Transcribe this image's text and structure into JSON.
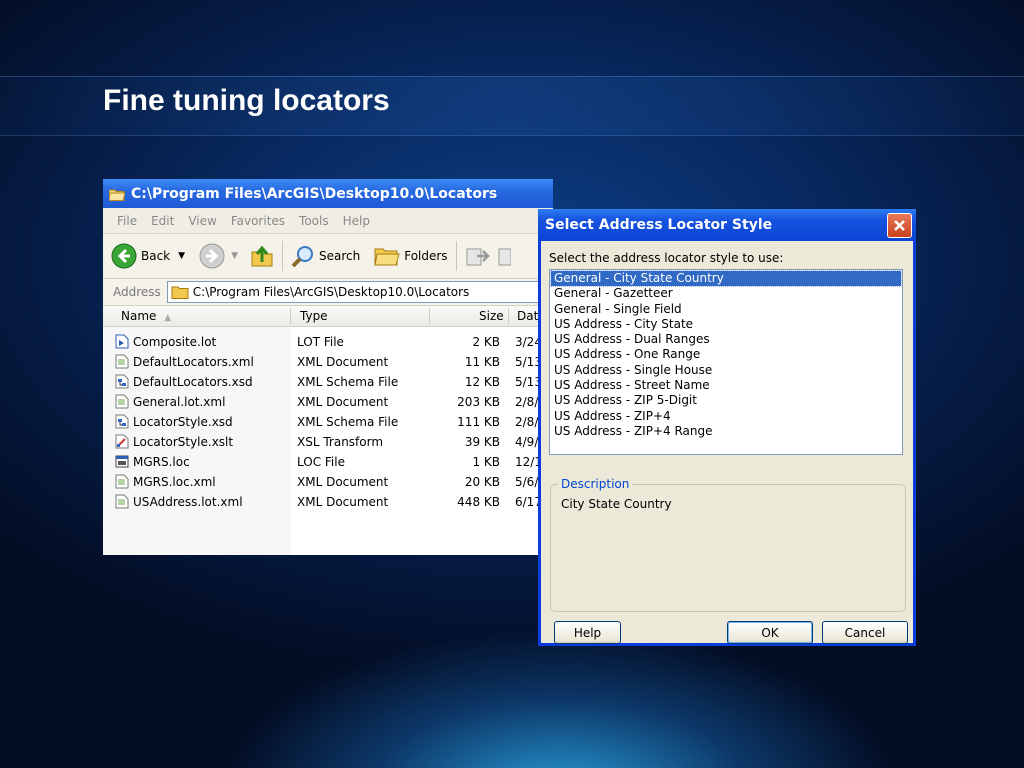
{
  "slide": {
    "title": "Fine tuning locators"
  },
  "explorer": {
    "title": "C:\\Program Files\\ArcGIS\\Desktop10.0\\Locators",
    "menu": [
      "File",
      "Edit",
      "View",
      "Favorites",
      "Tools",
      "Help"
    ],
    "toolbar": {
      "back": "Back",
      "search": "Search",
      "folders": "Folders"
    },
    "address_label": "Address",
    "address_value": "C:\\Program Files\\ArcGIS\\Desktop10.0\\Locators",
    "columns": {
      "name": "Name",
      "type": "Type",
      "size": "Size",
      "date": "Dat"
    },
    "files": [
      {
        "name": "Composite.lot",
        "type": "LOT File",
        "size": "2 KB",
        "date": "3/24",
        "icon": "lot-file-icon"
      },
      {
        "name": "DefaultLocators.xml",
        "type": "XML Document",
        "size": "11 KB",
        "date": "5/13",
        "icon": "xml-file-icon"
      },
      {
        "name": "DefaultLocators.xsd",
        "type": "XML Schema File",
        "size": "12 KB",
        "date": "5/13",
        "icon": "xsd-file-icon"
      },
      {
        "name": "General.lot.xml",
        "type": "XML Document",
        "size": "203 KB",
        "date": "2/8/",
        "icon": "xml-file-icon"
      },
      {
        "name": "LocatorStyle.xsd",
        "type": "XML Schema File",
        "size": "111 KB",
        "date": "2/8/",
        "icon": "xsd-file-icon"
      },
      {
        "name": "LocatorStyle.xslt",
        "type": "XSL Transform",
        "size": "39 KB",
        "date": "4/9/",
        "icon": "xslt-file-icon"
      },
      {
        "name": "MGRS.loc",
        "type": "LOC File",
        "size": "1 KB",
        "date": "12/1",
        "icon": "loc-file-icon"
      },
      {
        "name": "MGRS.loc.xml",
        "type": "XML Document",
        "size": "20 KB",
        "date": "5/6/",
        "icon": "xml-file-icon"
      },
      {
        "name": "USAddress.lot.xml",
        "type": "XML Document",
        "size": "448 KB",
        "date": "6/17",
        "icon": "xml-file-icon"
      }
    ]
  },
  "dialog": {
    "title": "Select Address Locator Style",
    "prompt": "Select the address locator style to use:",
    "styles": [
      "General - City State Country",
      "General - Gazetteer",
      "General - Single Field",
      "US Address - City State",
      "US Address - Dual Ranges",
      "US Address - One Range",
      "US Address - Single House",
      "US Address - Street Name",
      "US Address - ZIP 5-Digit",
      "US Address - ZIP+4",
      "US Address - ZIP+4 Range"
    ],
    "selected_index": 0,
    "description_label": "Description",
    "description_text": "City State Country",
    "buttons": {
      "help": "Help",
      "ok": "OK",
      "cancel": "Cancel"
    }
  },
  "colors": {
    "titlebar_blue": "#0a44d4",
    "selection": "#316ac5",
    "groupbox_label": "#0046d5",
    "close_red": "#c9401c"
  }
}
